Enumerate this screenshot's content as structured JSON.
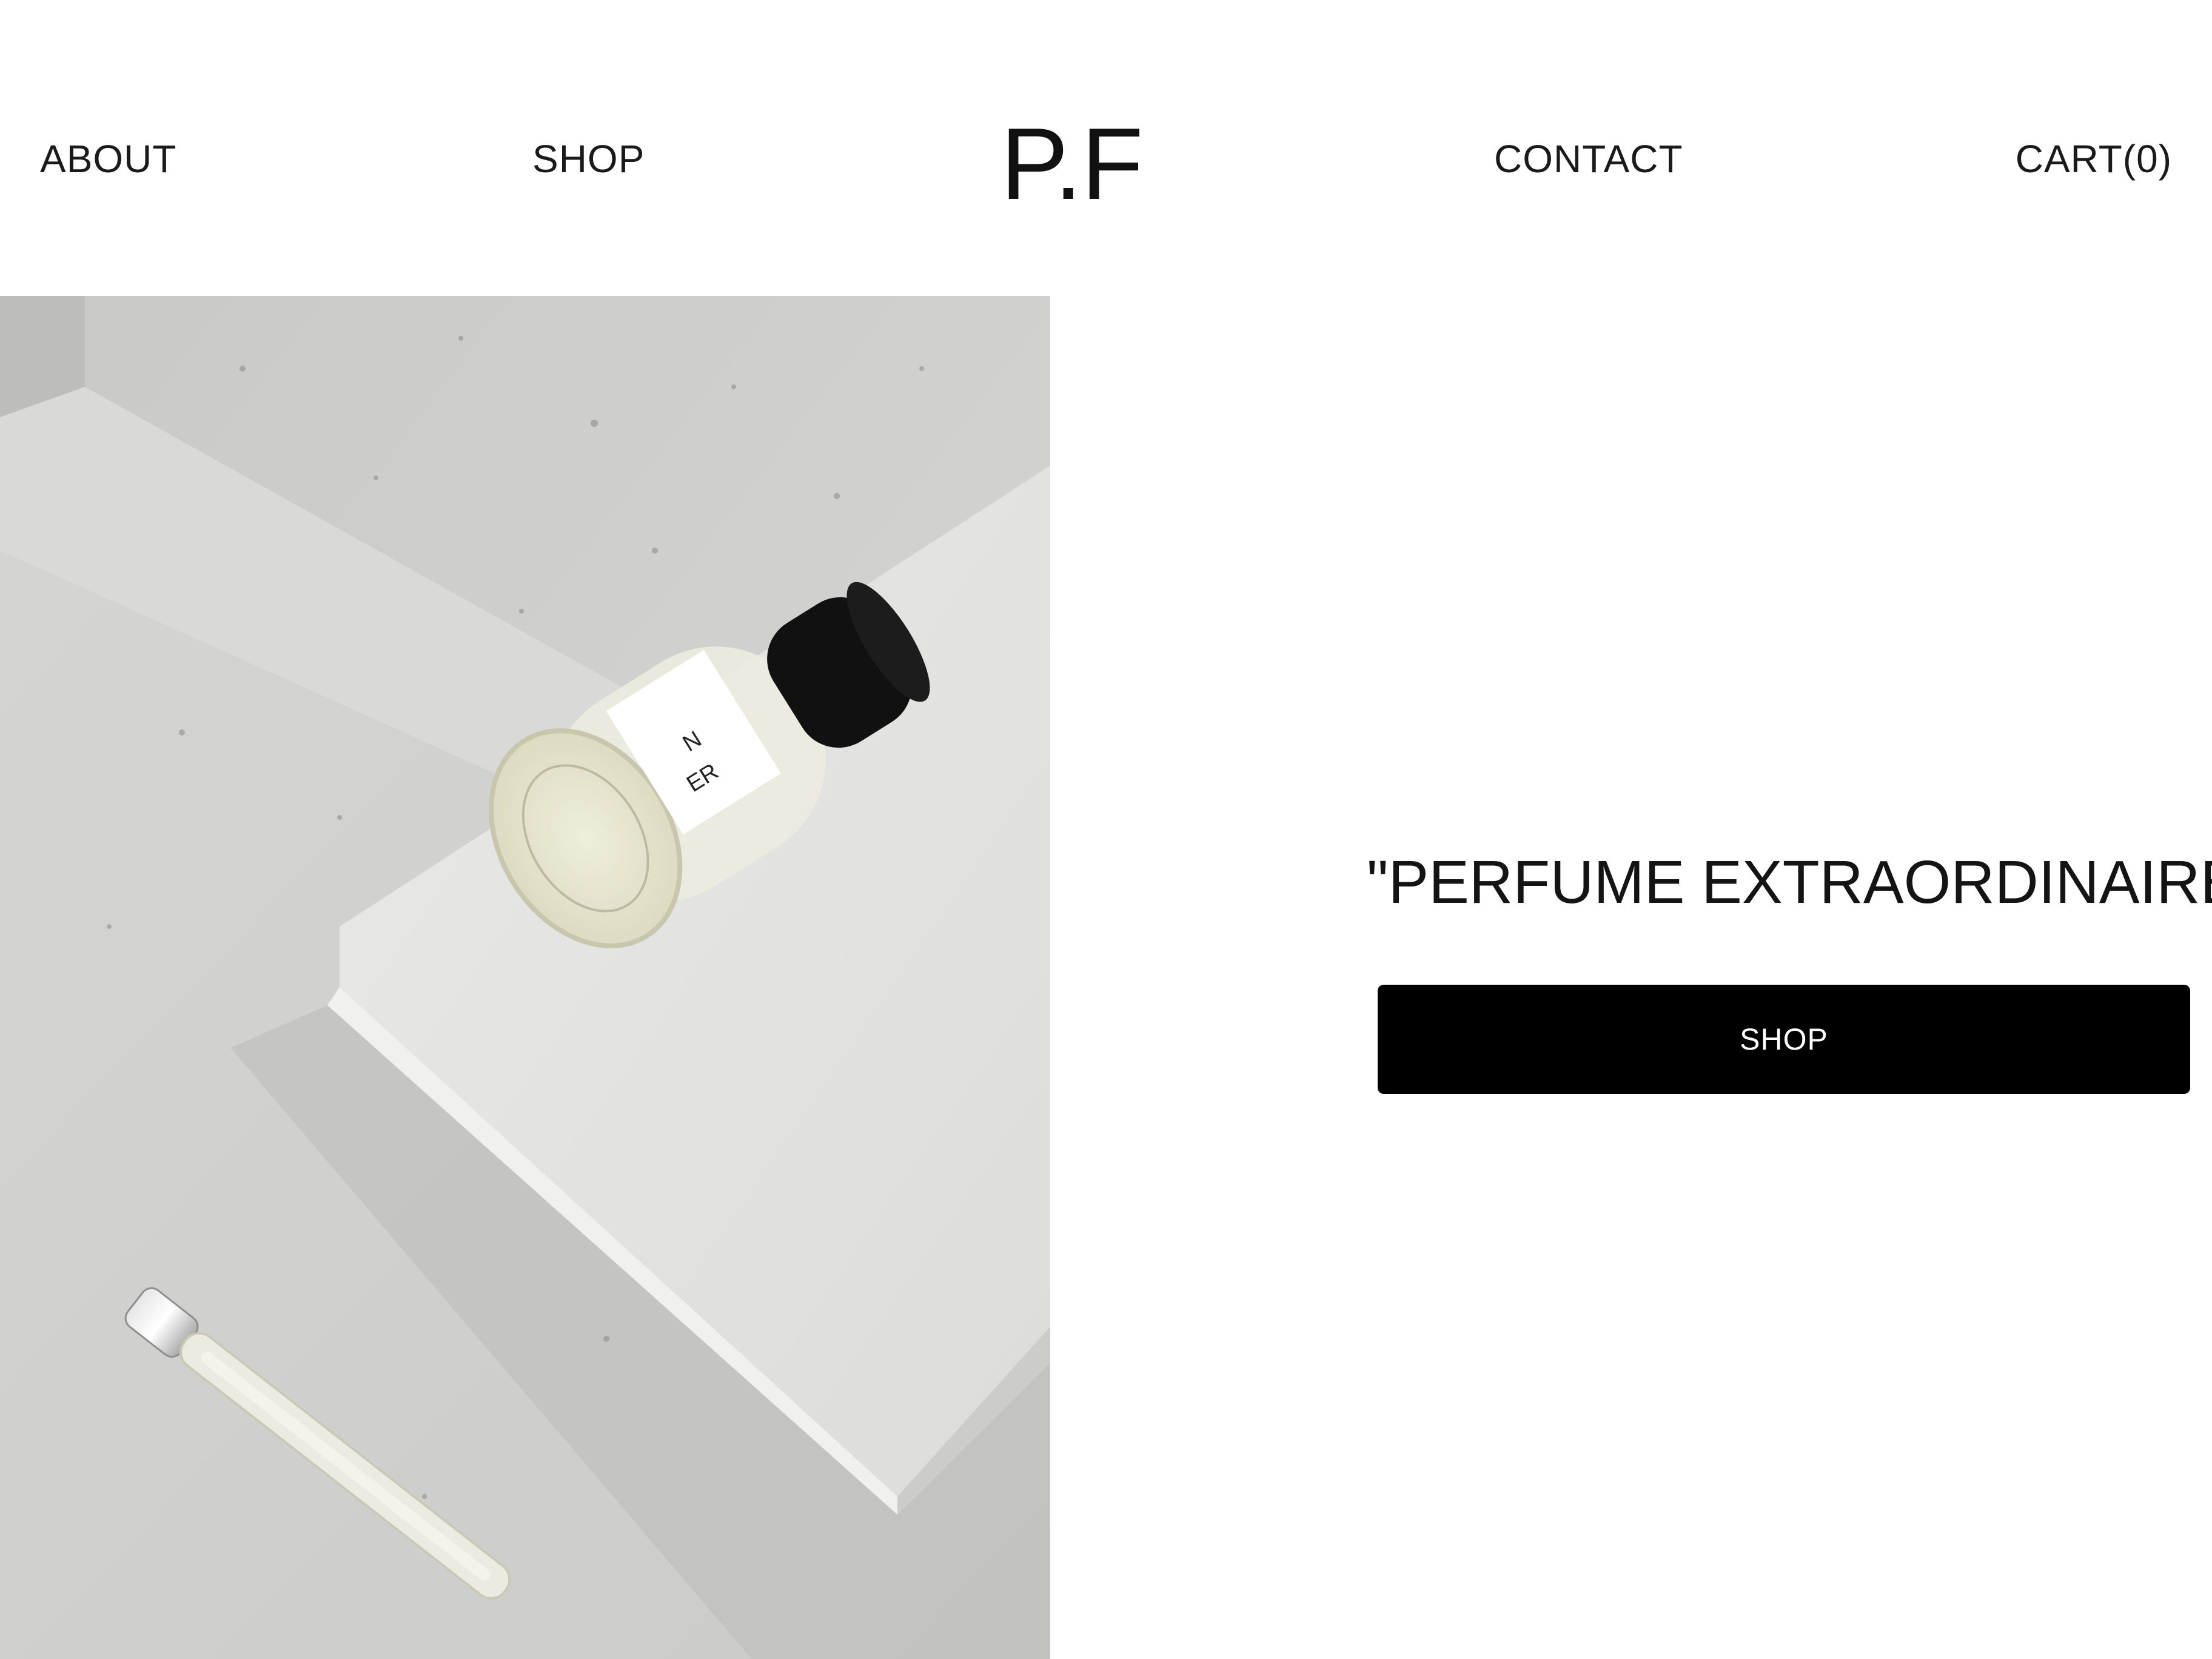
{
  "header": {
    "nav": {
      "about": "ABOUT",
      "shop": "SHOP",
      "contact": "CONTACT",
      "cart": "CART(0)"
    },
    "logo": "P.F"
  },
  "hero": {
    "image_subject": "perfume bottle and travel spray vial on concrete steps",
    "label_fragment_1": "N",
    "label_fragment_2": "ER"
  },
  "main": {
    "tagline": "\"PERFUME EXTRAORDINAIRE\"",
    "cta_label": "SHOP"
  },
  "colors": {
    "background": "#ffffff",
    "text": "#111111",
    "button_bg": "#000000",
    "button_text": "#ffffff",
    "concrete": "#cfcfcd"
  }
}
